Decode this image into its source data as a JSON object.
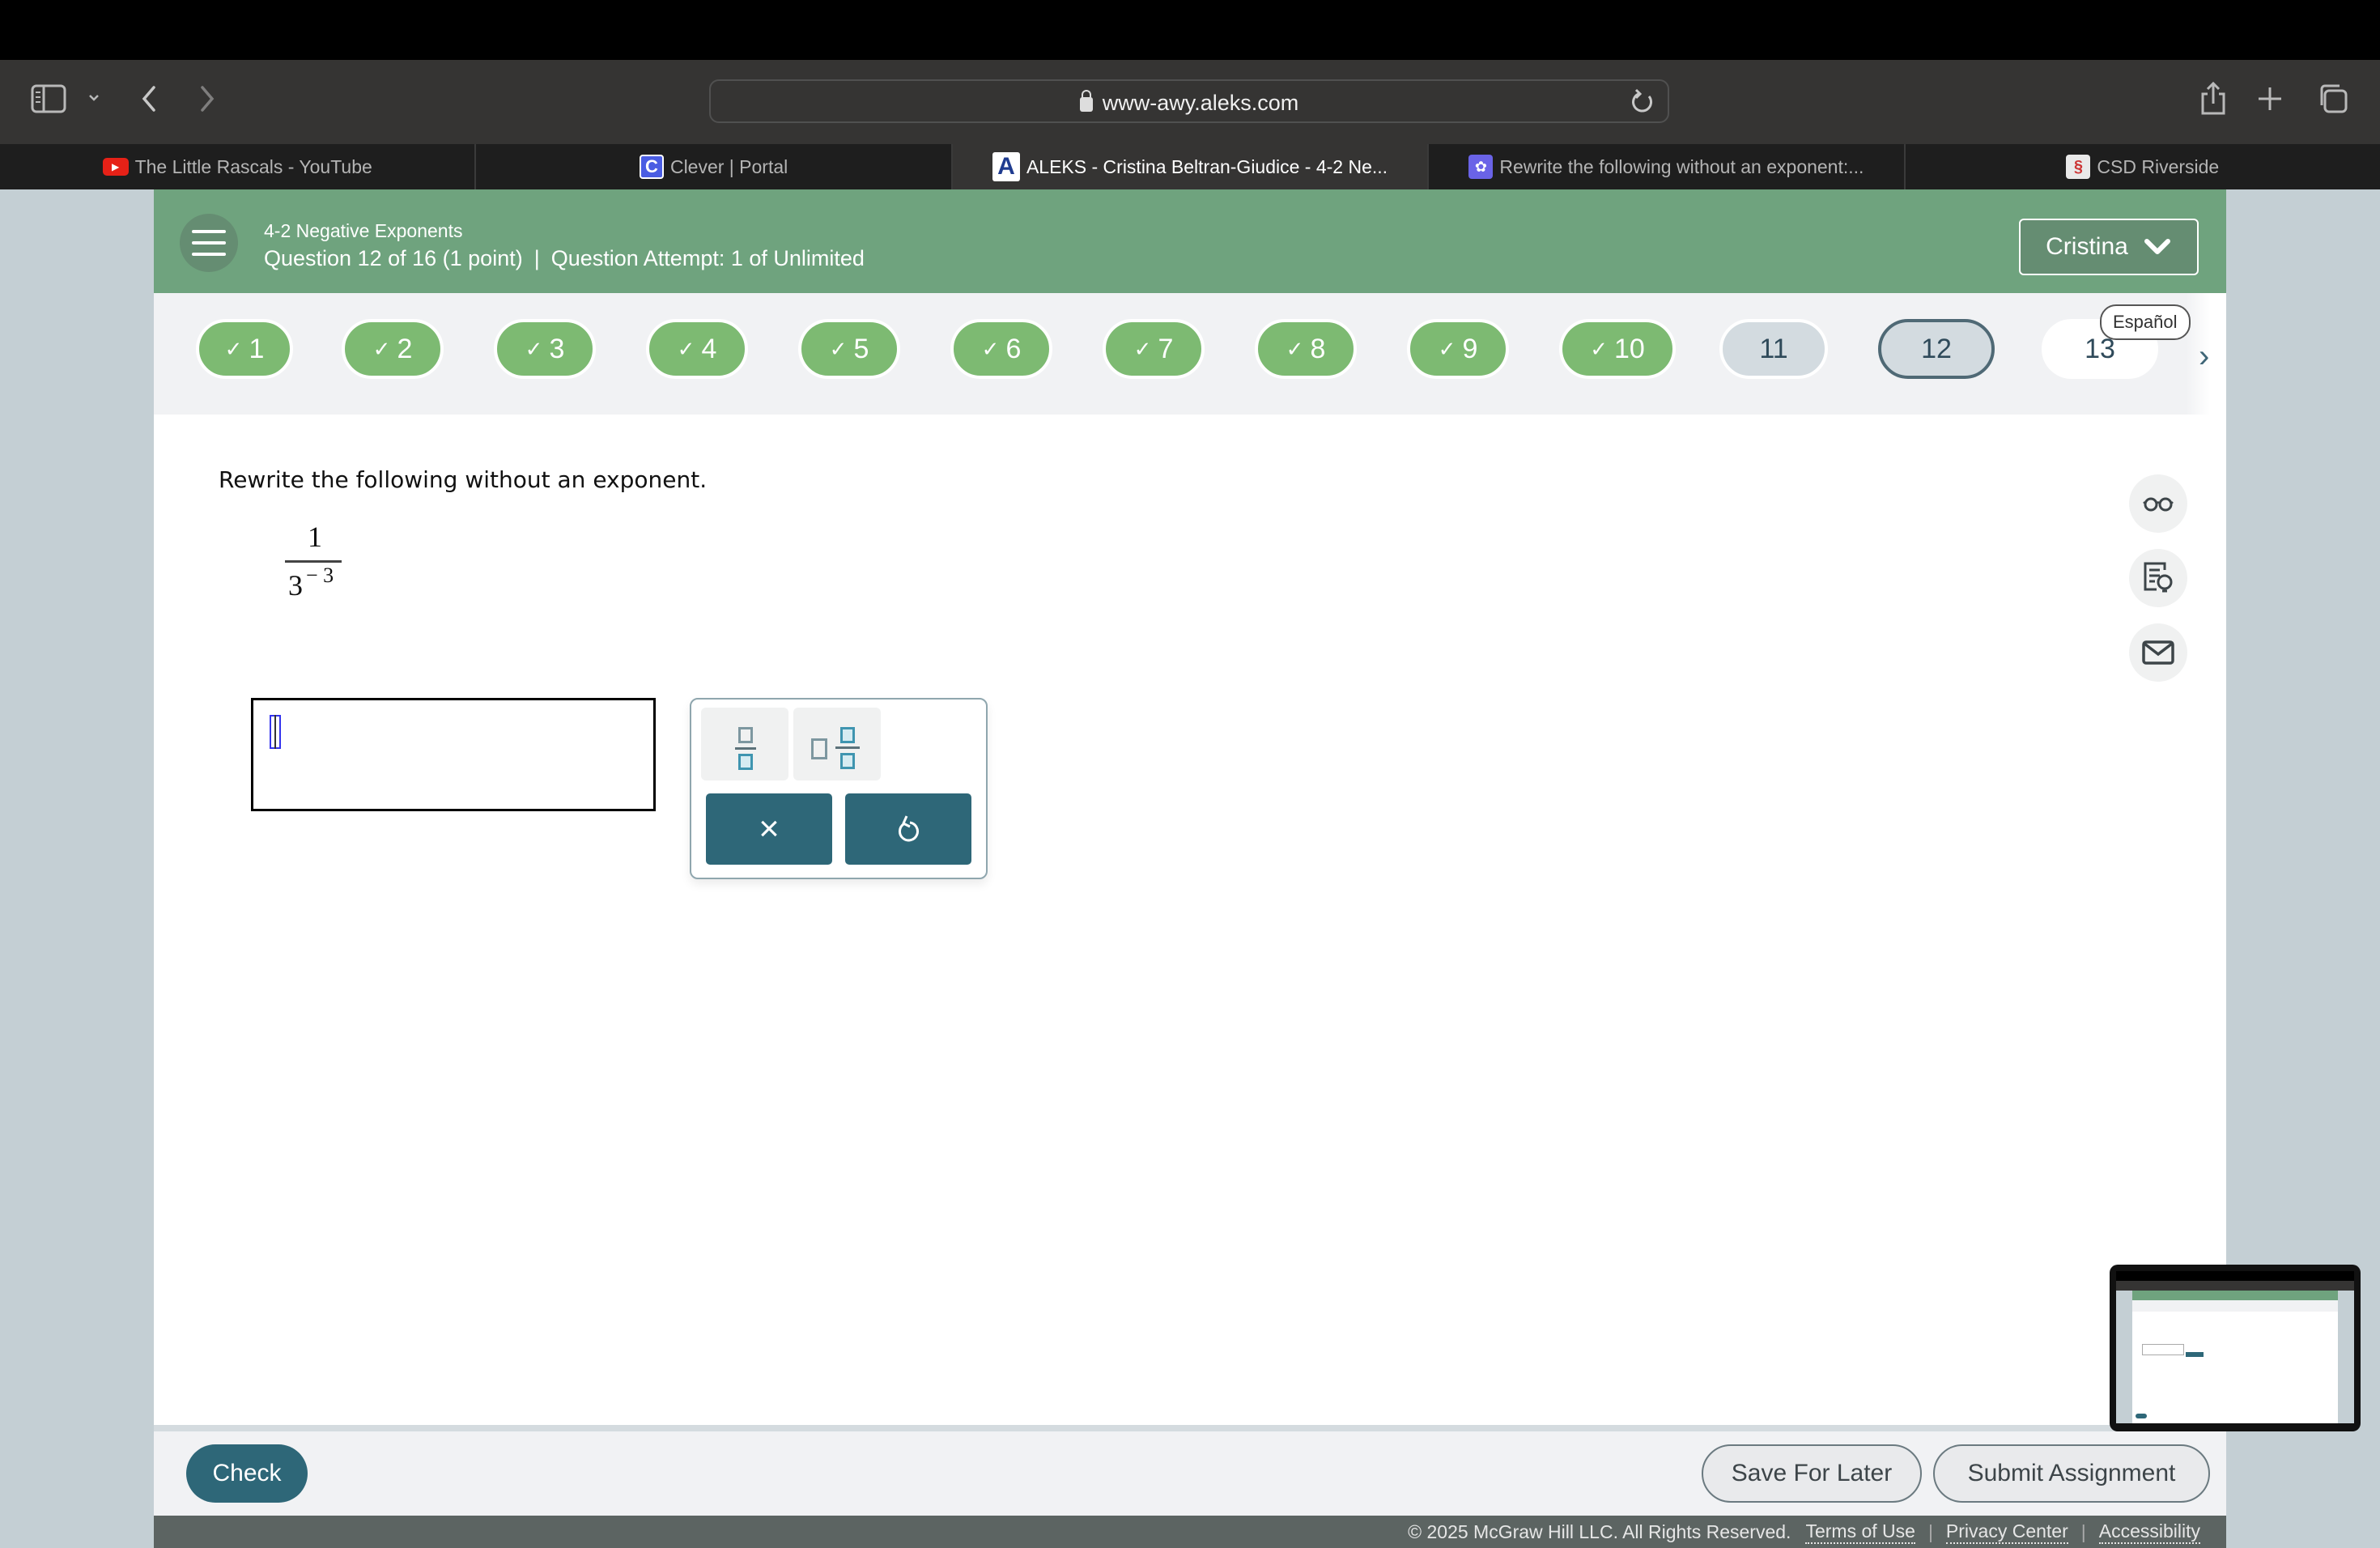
{
  "browser": {
    "url": "www-awy.aleks.com",
    "tabs": [
      {
        "label": "The Little Rascals - YouTube",
        "favicon": "youtube-icon",
        "active": false
      },
      {
        "label": "Clever | Portal",
        "favicon": "clever-icon",
        "active": false
      },
      {
        "label": "ALEKS - Cristina Beltran-Giudice - 4-2 Ne...",
        "favicon": "aleks-icon",
        "active": true
      },
      {
        "label": "Rewrite the following without an exponent:...",
        "favicon": "app-icon",
        "active": false
      },
      {
        "label": "CSD Riverside",
        "favicon": "csd-icon",
        "active": false
      }
    ]
  },
  "header": {
    "topic": "4-2 Negative Exponents",
    "question_info": "Question 12 of 16 (1 point)",
    "separator": "|",
    "attempt_info": "Question Attempt: 1 of Unlimited",
    "user_name": "Cristina"
  },
  "question_nav": {
    "language_button": "Español",
    "questions": [
      {
        "number": "1",
        "status": "done"
      },
      {
        "number": "2",
        "status": "done"
      },
      {
        "number": "3",
        "status": "done"
      },
      {
        "number": "4",
        "status": "done"
      },
      {
        "number": "5",
        "status": "done"
      },
      {
        "number": "6",
        "status": "done"
      },
      {
        "number": "7",
        "status": "done"
      },
      {
        "number": "8",
        "status": "done"
      },
      {
        "number": "9",
        "status": "done"
      },
      {
        "number": "10",
        "status": "done"
      },
      {
        "number": "11",
        "status": "visited"
      },
      {
        "number": "12",
        "status": "current"
      },
      {
        "number": "13",
        "status": "todo"
      }
    ],
    "check_glyph": "✓",
    "next_glyph": "›"
  },
  "question": {
    "prompt": "Rewrite the following without an exponent.",
    "numerator": "1",
    "denominator_base": "3",
    "denominator_exponent": "− 3"
  },
  "answer": {
    "value": ""
  },
  "keypad": {
    "clear_glyph": "×",
    "undo_glyph": "↺"
  },
  "footer": {
    "check_label": "Check",
    "save_label": "Save For Later",
    "submit_label": "Submit Assignment",
    "copyright": "© 2025 McGraw Hill LLC. All Rights Reserved.",
    "links": [
      "Terms of Use",
      "Privacy Center",
      "Accessibility"
    ]
  },
  "colors": {
    "header_green": "#6fa37e",
    "done_green": "#7dba72",
    "primary_teal": "#2e6778",
    "footer_gray": "#5c6462"
  }
}
